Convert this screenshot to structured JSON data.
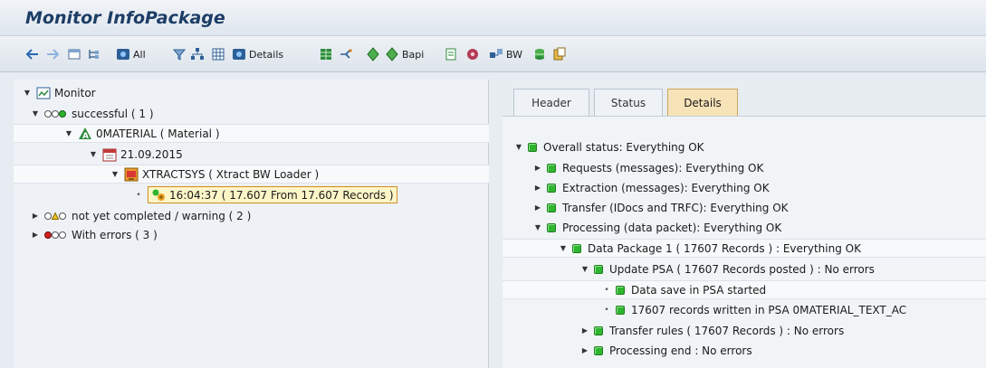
{
  "title": "Monitor InfoPackage",
  "toolbar": {
    "all_label": "All",
    "details_label": "Details",
    "bapi_label": "Bapi",
    "bw_label": "BW"
  },
  "tree": {
    "root": "Monitor",
    "successful": "successful ( 1 )",
    "material": "0MATERIAL ( Material )",
    "date": "21.09.2015",
    "source": "XTRACTSYS ( Xtract BW Loader )",
    "request": "16:04:37 ( 17.607 From 17.607 Records )",
    "warning": "not yet completed / warning ( 2 )",
    "errors": "With errors ( 3 )"
  },
  "tabs": [
    "Header",
    "Status",
    "Details"
  ],
  "active_tab": "Details",
  "details": {
    "overall": "Overall status: Everything OK",
    "requests": "Requests (messages): Everything OK",
    "extraction": "Extraction (messages): Everything OK",
    "transfer": "Transfer (IDocs and TRFC): Everything OK",
    "processing": "Processing (data packet): Everything OK",
    "package": "Data Package 1 ( 17607 Records ) : Everything OK",
    "update_psa": "Update PSA ( 17607  Records posted ) : No errors",
    "save_started": "Data save in PSA started",
    "written": "17607 records written in PSA 0MATERIAL_TEXT_AC",
    "transfer_rules": "Transfer rules ( 17607  Records ) : No errors",
    "processing_end": "Processing end : No errors"
  },
  "colors": {
    "ok_green": "#2fb52f",
    "active_tab": "#f7e3b8",
    "highlight_border": "#d08a24"
  }
}
